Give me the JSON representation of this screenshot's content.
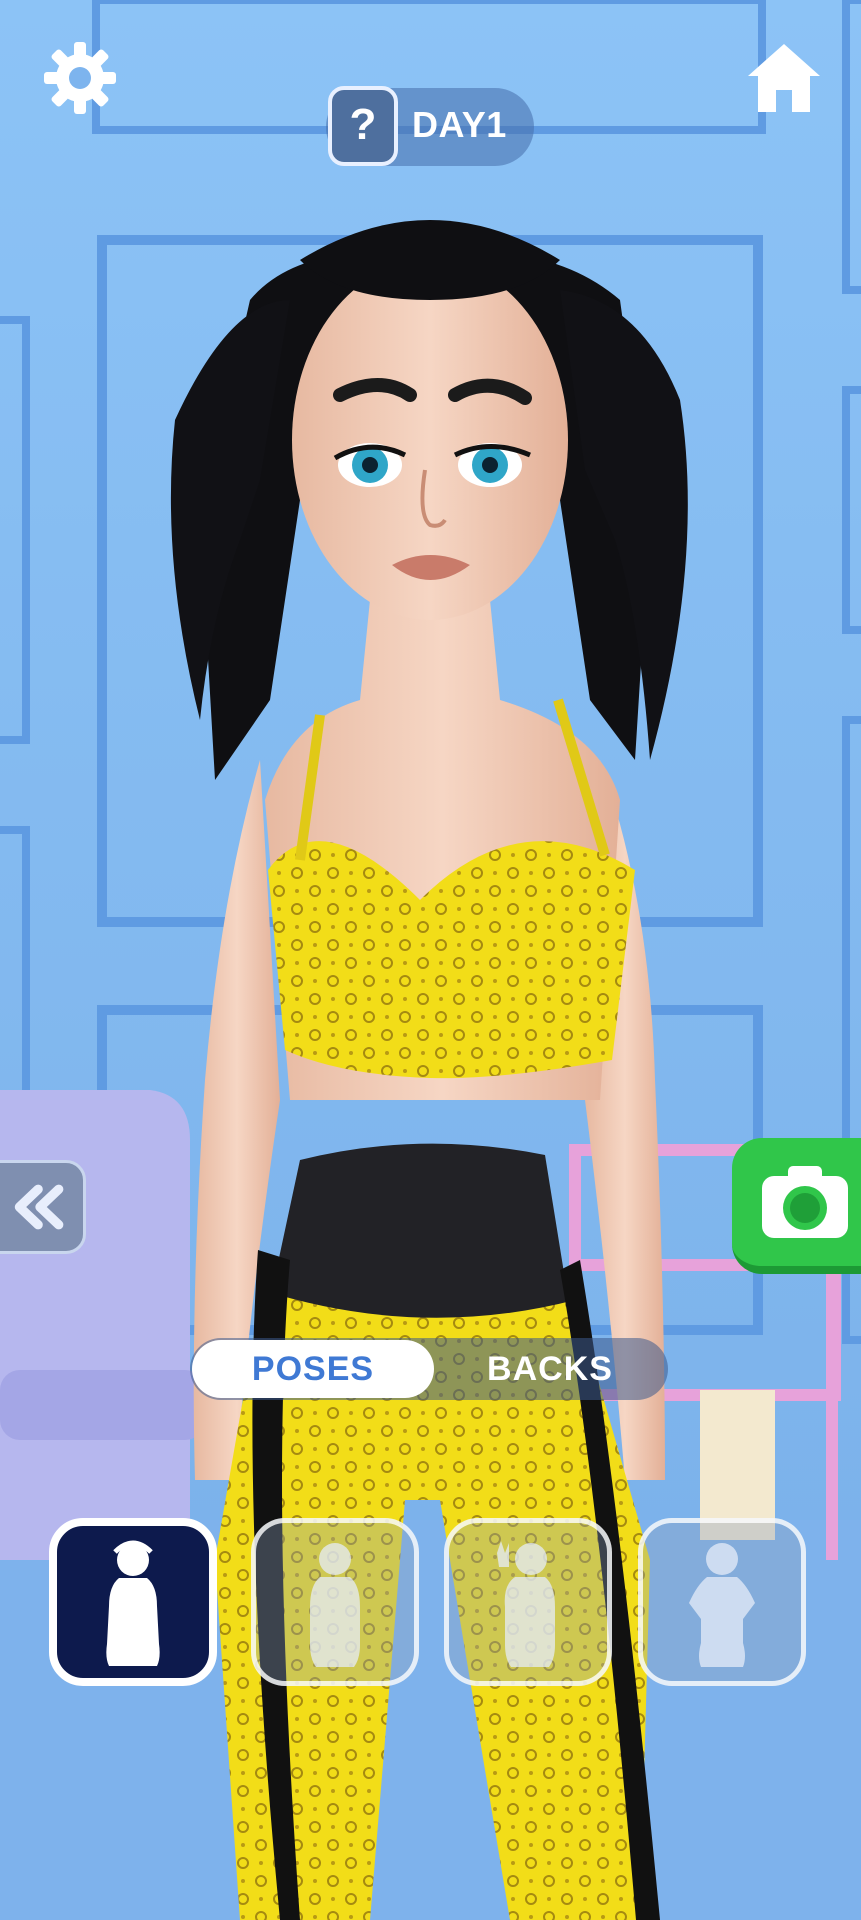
{
  "header": {
    "day_label": "DAY1",
    "help_symbol": "?",
    "settings_icon": "gear-icon",
    "home_icon": "home-icon"
  },
  "tabs": [
    {
      "label": "POSES",
      "selected": true
    },
    {
      "label": "BACKS",
      "selected": false
    }
  ],
  "side_buttons": {
    "back_icon": "double-chevron-left-icon",
    "camera_icon": "camera-icon"
  },
  "poses": [
    {
      "name": "pose-standing",
      "selected": true
    },
    {
      "name": "pose-hands-behind",
      "selected": false
    },
    {
      "name": "pose-peace-sign",
      "selected": false
    },
    {
      "name": "pose-hands-on-hips",
      "selected": false
    }
  ],
  "colors": {
    "accent": "#3f79d4",
    "camera_button": "#30c64a",
    "selected_card": "#0d1a4d",
    "outfit_yellow": "#f4e21f"
  }
}
